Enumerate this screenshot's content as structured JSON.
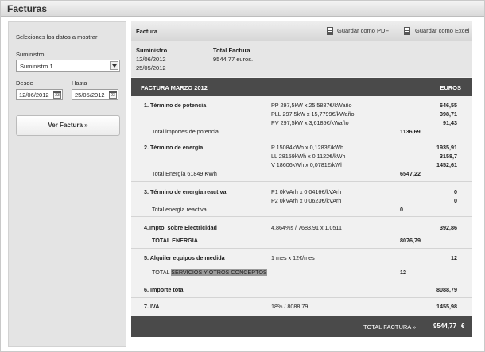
{
  "window": {
    "title": "Facturas"
  },
  "sidebar": {
    "heading": "Seleciones los datos a mostrar",
    "suministro_label": "Suministro",
    "suministro_value": "Suministro 1",
    "desde_label": "Desde",
    "hasta_label": "Hasta",
    "desde_value": "12/06/2012",
    "hasta_value": "25/05/2012",
    "calendar_day": "23",
    "ver_button": "Ver Factura »"
  },
  "header": {
    "label": "Factura",
    "pdf_action": "Guardar como PDF",
    "excel_action": "Guardar como Excel"
  },
  "summary": {
    "suministro_label": "Suministro",
    "total_label": "Total Factura",
    "date1": "12/06/2012",
    "date2": "25/05/2012",
    "total_value": "9544,77 euros."
  },
  "invoice": {
    "title": "FACTURA MARZO 2012",
    "currency_label": "EUROS",
    "sections": {
      "potencia": {
        "title": "1. Término de potencia",
        "lines": [
          {
            "desc": "PP 297,5kW x 25,5887€/kWaño",
            "amount": "646,55"
          },
          {
            "desc": "PLL 297,5kW x 15,7799€/kWaño",
            "amount": "398,71"
          },
          {
            "desc": "PV 297,5kW x 3,6185€/kWaño",
            "amount": "91,43"
          }
        ],
        "subtotal_label": "Total importes de potencia",
        "subtotal": "1136,69"
      },
      "energia": {
        "title": "2. Término de energía",
        "lines": [
          {
            "desc": "P 15084kWh x 0,1283€/kWh",
            "amount": "1935,91"
          },
          {
            "desc": "LL 28159kWh x 0,1122€/kWh",
            "amount": "3158,7"
          },
          {
            "desc": "V 18606kWh x 0,0781€/kWh",
            "amount": "1452,61"
          }
        ],
        "subtotal_label": "Total Energía 61849 KWh",
        "subtotal": "6547,22"
      },
      "reactiva": {
        "title": "3. Término de energía reactiva",
        "lines": [
          {
            "desc": "P1 0kVArh x 0,0416€/kVArh",
            "amount": "0"
          },
          {
            "desc": "P2 0kVArh x 0,0623€/kVArh",
            "amount": "0"
          }
        ],
        "subtotal_label": "Total energía reactiva",
        "subtotal": "0"
      },
      "impuesto": {
        "title": "4.Impto. sobre Electricidad",
        "desc": "4,864%s / 7683,91 x 1,0511",
        "amount": "392,86",
        "subtotal_label": "TOTAL ENERGIA",
        "subtotal": "8076,79"
      },
      "alquiler": {
        "title": "5. Alquiler equipos de medida",
        "desc": "1 mes x 12€/mes",
        "amount": "12",
        "subtotal_label_prefix": "TOTAL ",
        "subtotal_label_highlight": "SERVICIOS Y OTROS CONCEPTOS",
        "subtotal": "12"
      },
      "importe": {
        "title": "6. Importe total",
        "amount": "8088,79"
      },
      "iva": {
        "title": "7. IVA",
        "desc": "18% / 8088,79",
        "amount": "1455,98"
      }
    },
    "footer": {
      "label": "TOTAL FACTURA »",
      "value": "9544,77",
      "currency": "€"
    }
  }
}
